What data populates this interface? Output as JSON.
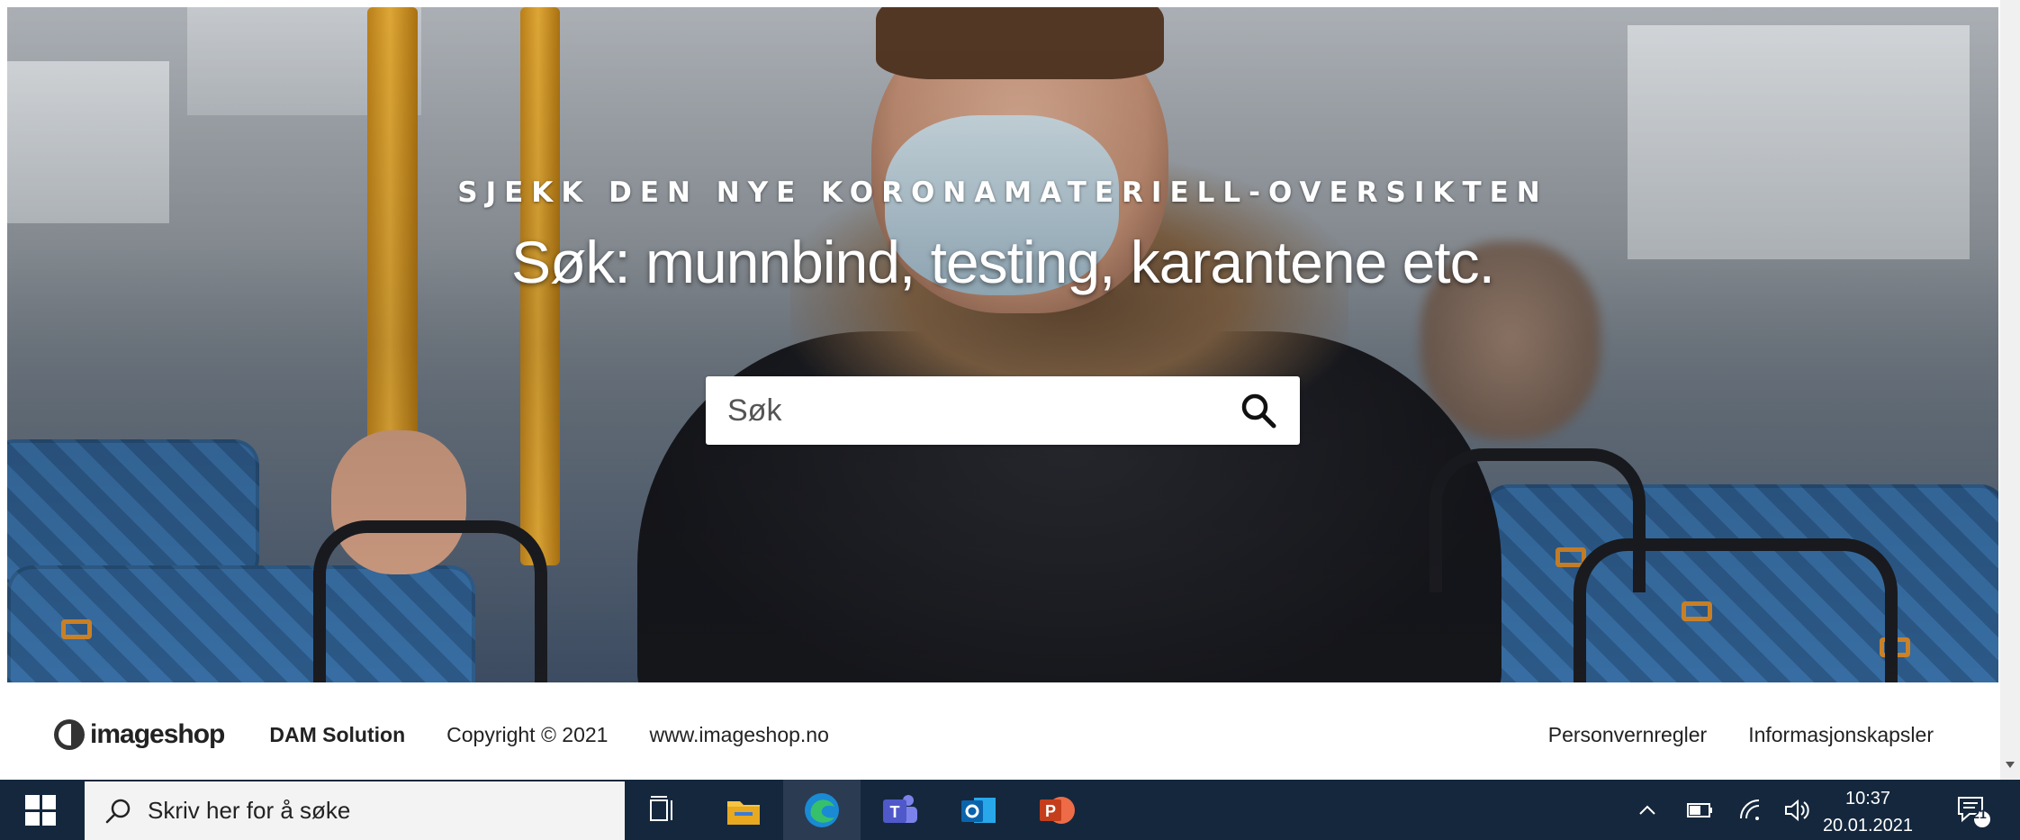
{
  "hero": {
    "kicker": "SJEKK DEN NYE KORONAMATERIELL-OVERSIKTEN",
    "title": "Søk: munnbind, testing, karantene etc.",
    "search_placeholder": "Søk"
  },
  "footer": {
    "logo_text": "imageshop",
    "product": "DAM Solution",
    "copyright": "Copyright © 2021",
    "website": "www.imageshop.no",
    "links": [
      "Personvernregler",
      "Informasjonskapsler"
    ]
  },
  "taskbar": {
    "search_placeholder": "Skriv her for å søke",
    "apps": [
      "task-view-icon",
      "file-explorer-icon",
      "edge-icon",
      "teams-icon",
      "outlook-icon",
      "powerpoint-icon"
    ],
    "time": "10:37",
    "date": "20.01.2021",
    "notification_count": "21"
  }
}
